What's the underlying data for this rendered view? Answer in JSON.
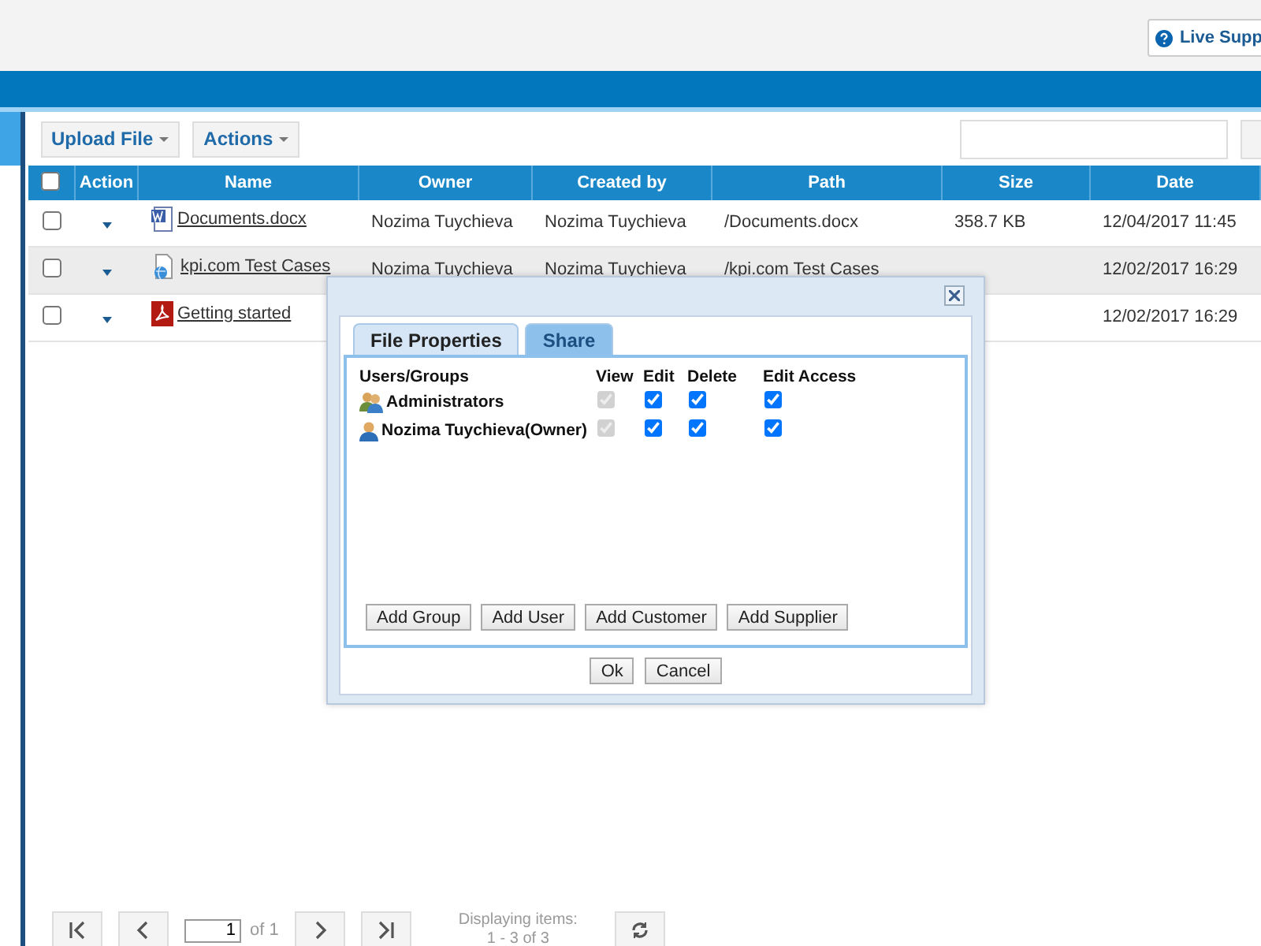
{
  "header": {
    "live_support": "Live Supp"
  },
  "toolbar": {
    "buttons": [
      "Upload File",
      "Actions"
    ]
  },
  "table": {
    "select_all": {
      "checked": false
    },
    "columns": [
      "Action",
      "Name",
      "Owner",
      "Created by",
      "Path",
      "Size",
      "Date"
    ],
    "rows": [
      {
        "checked": false,
        "highlighted": false,
        "kind": "word",
        "name": "Documents.docx",
        "owner": "Nozima Tuychieva",
        "created_by": "Nozima Tuychieva",
        "path": "/Documents.docx",
        "size": "358.7 KB",
        "date": "12/04/2017 11:45"
      },
      {
        "checked": false,
        "highlighted": true,
        "kind": "web",
        "name": "kpi.com Test Cases",
        "owner": "Nozima Tuychieva",
        "created_by": "Nozima Tuychieva",
        "path": "/kpi.com Test Cases",
        "date": "12/02/2017 16:29"
      },
      {
        "checked": false,
        "highlighted": false,
        "kind": "pdf",
        "name": "Getting started",
        "date": "12/02/2017 16:29"
      }
    ]
  },
  "dialog": {
    "tabs": [
      {
        "label": "File Properties",
        "selected": false
      },
      {
        "label": "Share",
        "selected": true
      }
    ],
    "columns": [
      "Users/Groups",
      "View",
      "Edit",
      "Delete",
      "Edit Access"
    ],
    "entries": [
      {
        "kind": "group",
        "name": "Administrators",
        "permissions": [
          {
            "checked": true,
            "disabled": true
          },
          {
            "checked": true,
            "disabled": false
          },
          {
            "checked": true,
            "disabled": false
          },
          {
            "checked": true,
            "disabled": false
          }
        ]
      },
      {
        "kind": "user",
        "name": "Nozima Tuychieva(Owner)",
        "permissions": [
          {
            "checked": true,
            "disabled": true
          },
          {
            "checked": true,
            "disabled": false
          },
          {
            "checked": true,
            "disabled": false
          },
          {
            "checked": true,
            "disabled": false
          }
        ]
      }
    ],
    "add_buttons": [
      "Add Group",
      "Add User",
      "Add Customer",
      "Add Supplier"
    ],
    "buttons": [
      "Ok",
      "Cancel"
    ]
  },
  "pager": {
    "page": "1",
    "of": "of 1",
    "status": "Displaying items:",
    "range": "1 - 3 of 3"
  }
}
